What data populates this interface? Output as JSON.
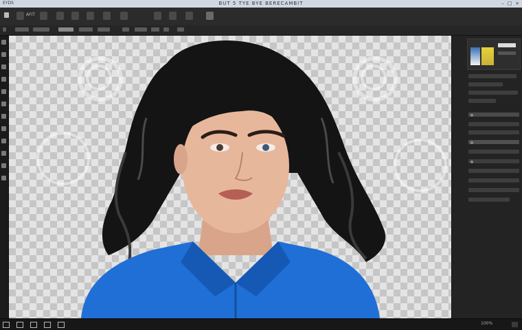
{
  "window": {
    "title": "BUT 5 TYE BYE BERECAMBIT",
    "left_label": "EYDS",
    "controls": [
      "minimize",
      "maximize",
      "close"
    ]
  },
  "menubar": {
    "items": [
      "AFIT"
    ],
    "toolbar_icons": [
      "file-icon",
      "edit-icon",
      "image-icon",
      "layer-icon",
      "select-icon",
      "filter-icon",
      "view-icon",
      "window-icon",
      "help-icon"
    ]
  },
  "canvas": {
    "background": "transparency-checkerboard",
    "subject": "portrait-of-woman-with-dark-curly-hair-in-blue-shirt",
    "shirt_color": "#1f6fd6",
    "hair_color": "#1a1a1a"
  },
  "right_panel": {
    "swatches": [
      "#3b6fb5",
      "#f4f4f4",
      "#e8d23a",
      "#c9b23a"
    ]
  },
  "statusbar": {
    "zoom": "100%"
  },
  "colors": {
    "chrome": "#2b2b2b",
    "panel": "#232323",
    "titlebar": "#cfd8e2"
  }
}
